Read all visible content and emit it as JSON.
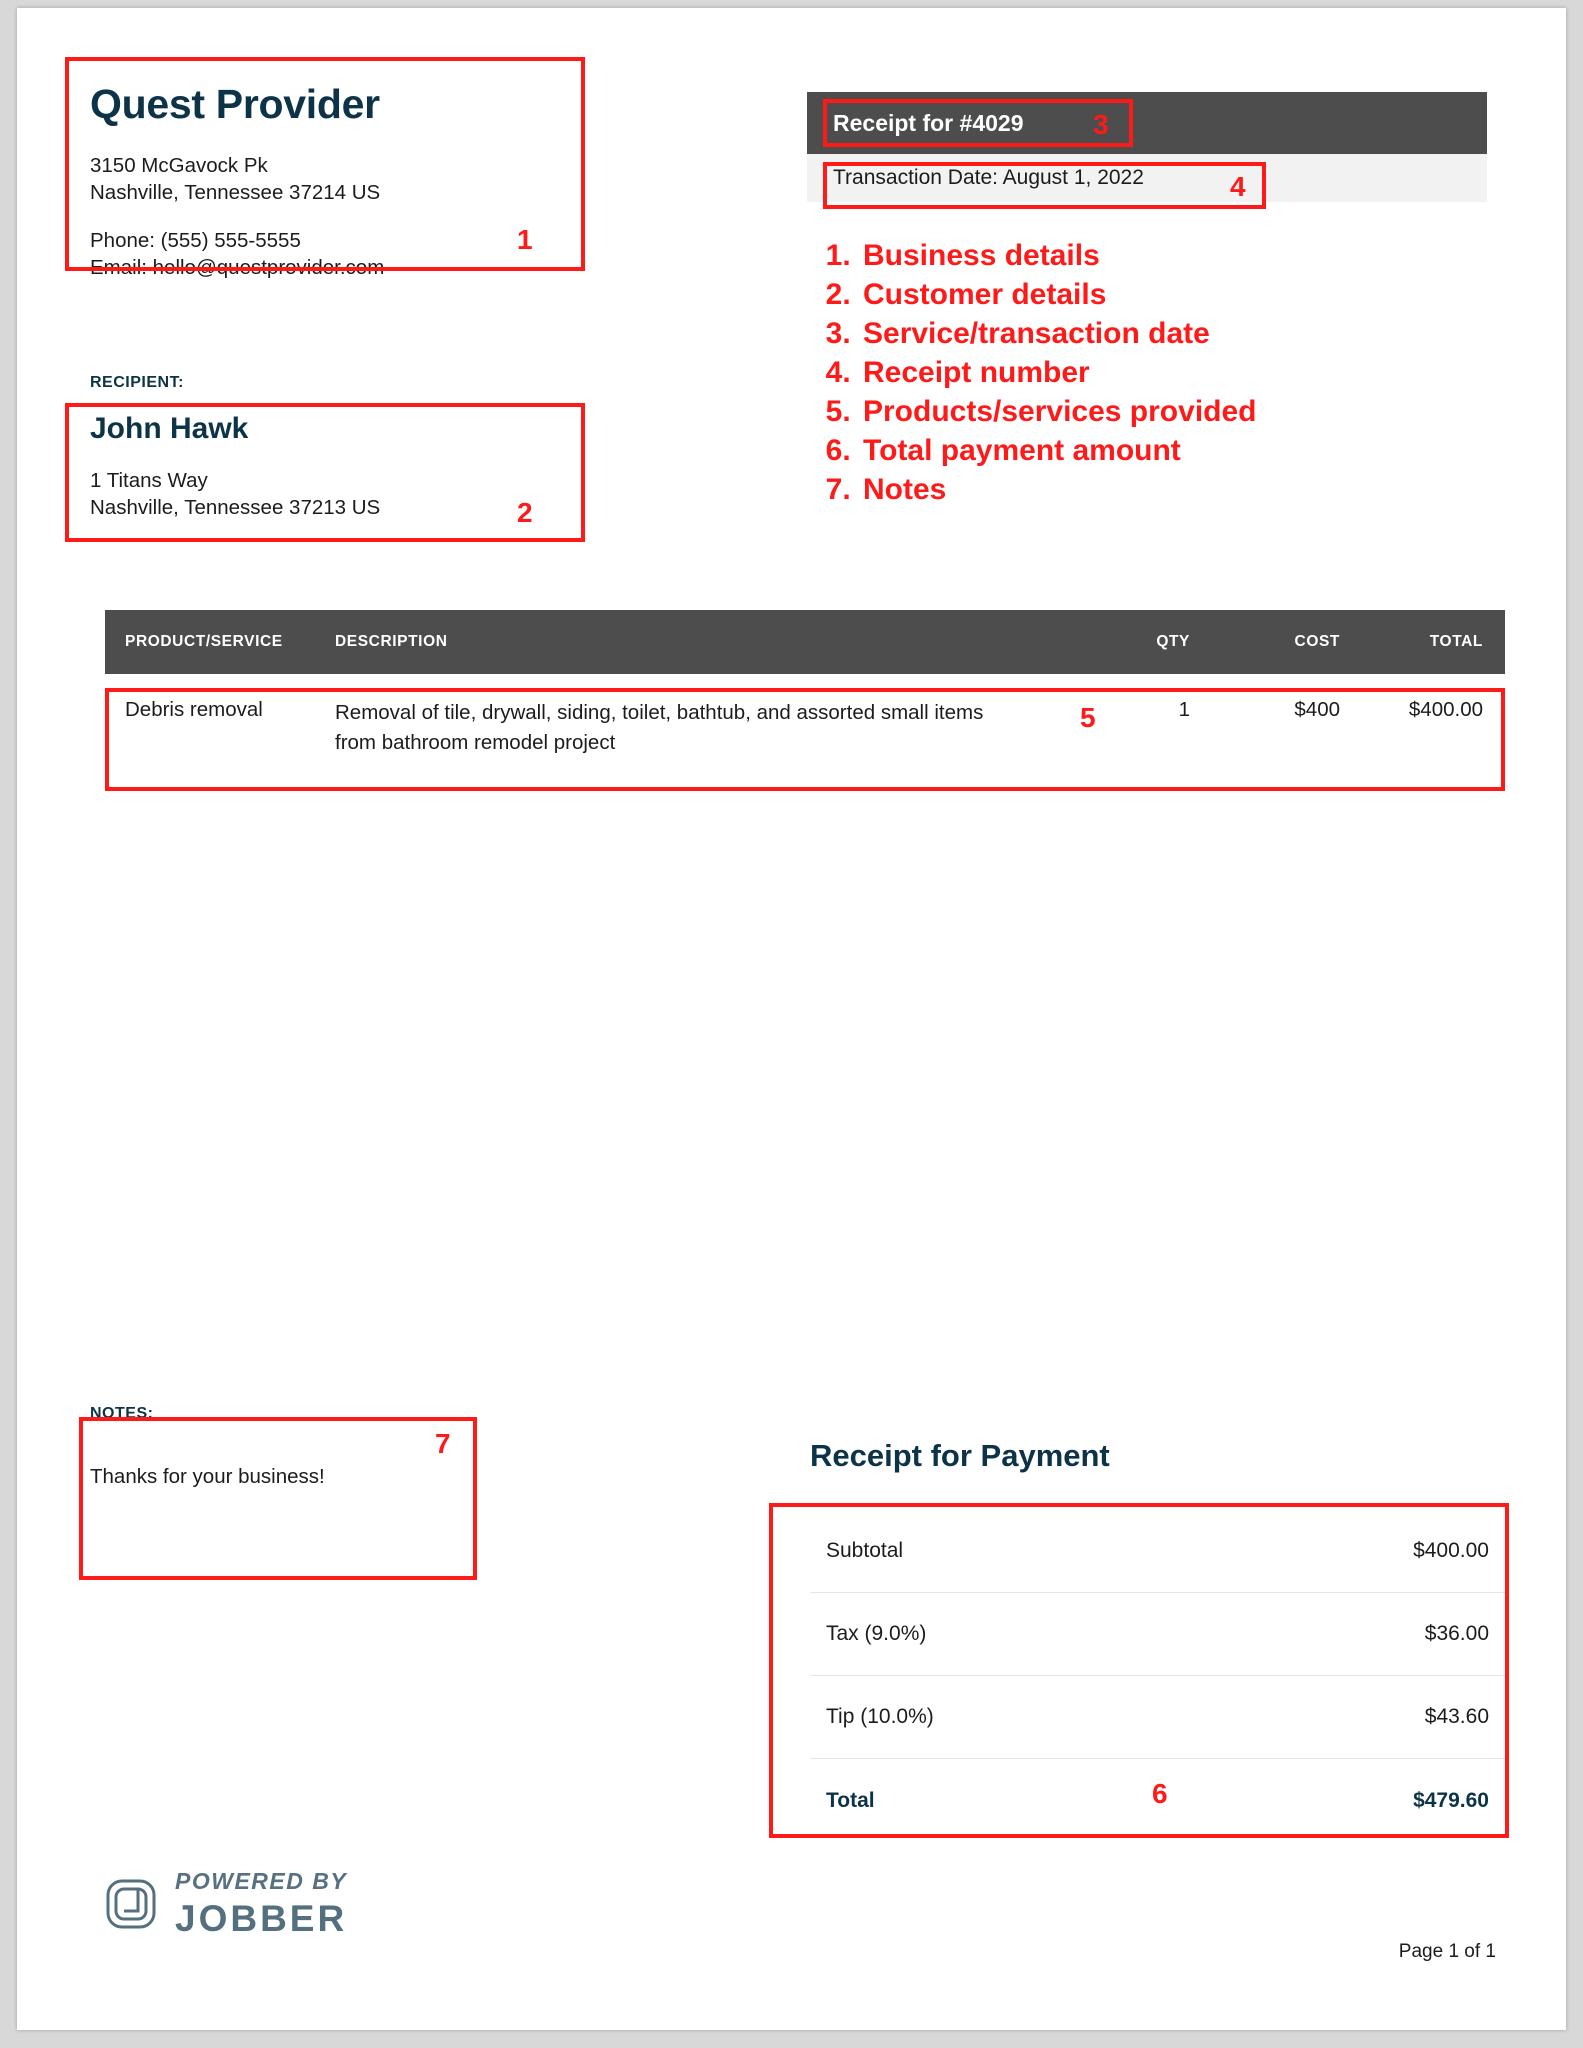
{
  "business": {
    "name": "Quest Provider",
    "address_line1": "3150 McGavock Pk",
    "address_line2": "Nashville, Tennessee 37214 US",
    "phone": "Phone: (555) 555-5555",
    "email": "Email: hello@questprovider.com"
  },
  "recipient": {
    "label": "RECIPIENT:",
    "name": "John Hawk",
    "address_line1": "1 Titans Way",
    "address_line2": "Nashville, Tennessee 37213 US"
  },
  "receipt_header": {
    "title": "Receipt for #4029",
    "transaction_date": "Transaction Date: August 1, 2022"
  },
  "legend": {
    "items": [
      "Business details",
      "Customer details",
      "Service/transaction date",
      "Receipt number",
      "Products/services provided",
      "Total payment amount",
      "Notes"
    ]
  },
  "annotations": {
    "markers": [
      "1",
      "2",
      "3",
      "4",
      "5",
      "6",
      "7"
    ]
  },
  "line_items": {
    "headers": {
      "product": "PRODUCT/SERVICE",
      "description": "DESCRIPTION",
      "qty": "QTY",
      "cost": "COST",
      "total": "TOTAL"
    },
    "rows": [
      {
        "product": "Debris removal",
        "description": "Removal of tile, drywall, siding, toilet, bathtub, and assorted small items from bathroom remodel project",
        "qty": "1",
        "cost": "$400",
        "total": "$400.00"
      }
    ]
  },
  "notes": {
    "label": "NOTES:",
    "text": "Thanks for your business!"
  },
  "summary": {
    "title": "Receipt for Payment",
    "rows": [
      {
        "label": "Subtotal",
        "value": "$400.00"
      },
      {
        "label": "Tax (9.0%)",
        "value": "$36.00"
      },
      {
        "label": "Tip (10.0%)",
        "value": "$43.60"
      },
      {
        "label": "Total",
        "value": "$479.60"
      }
    ]
  },
  "footer": {
    "powered_by": "POWERED BY",
    "brand": "JOBBER",
    "page": "Page 1 of 1"
  },
  "colors": {
    "heading_navy": "#0d3349",
    "header_bar_gray": "#4d4d4d",
    "annotation_red": "#ff1a1a",
    "logo_slate": "#54707e"
  }
}
